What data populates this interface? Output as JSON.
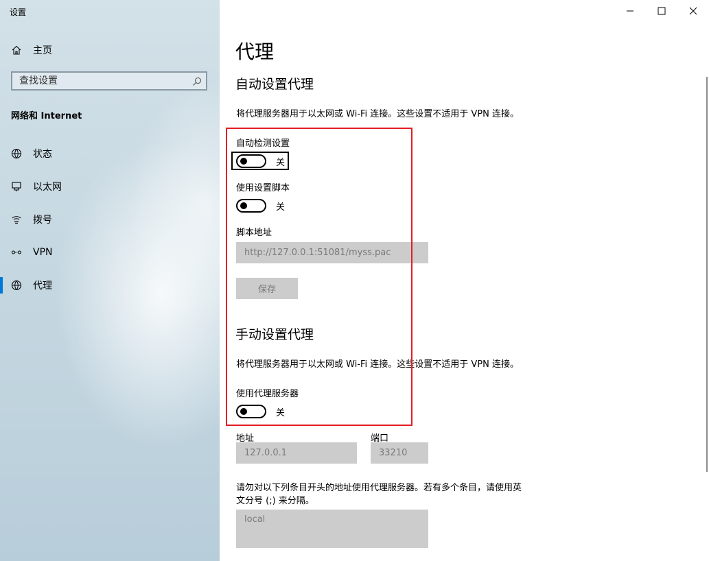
{
  "window": {
    "title": "设置",
    "controls": [
      "minimize-icon",
      "maximize-icon",
      "close-icon"
    ]
  },
  "sidebar": {
    "home": {
      "label": "主页",
      "icon": "home-icon"
    },
    "search": {
      "placeholder": "查找设置",
      "icon": "search-icon"
    },
    "section_title": "网络和 Internet",
    "items": [
      {
        "label": "状态",
        "icon": "globe-status-icon",
        "active": false
      },
      {
        "label": "以太网",
        "icon": "ethernet-icon",
        "active": false
      },
      {
        "label": "拨号",
        "icon": "dialup-icon",
        "active": false
      },
      {
        "label": "VPN",
        "icon": "vpn-icon",
        "active": false
      },
      {
        "label": "代理",
        "icon": "globe-icon",
        "active": true
      }
    ],
    "accent_color": "#0078d7"
  },
  "main": {
    "title": "代理",
    "auto": {
      "heading": "自动设置代理",
      "description": "将代理服务器用于以太网或 Wi-Fi 连接。这些设置不适用于 VPN 连接。",
      "detect": {
        "label": "自动检测设置",
        "state": "关"
      },
      "script": {
        "label": "使用设置脚本",
        "state": "关"
      },
      "script_address": {
        "label": "脚本地址",
        "value": "http://127.0.0.1:51081/myss.pac"
      },
      "save_label": "保存"
    },
    "manual": {
      "heading": "手动设置代理",
      "description": "将代理服务器用于以太网或 Wi-Fi 连接。这些设置不适用于 VPN 连接。",
      "use_proxy": {
        "label": "使用代理服务器",
        "state": "关"
      },
      "address": {
        "label": "地址",
        "value": "127.0.0.1"
      },
      "port": {
        "label": "端口",
        "value": "33210"
      },
      "exceptions": {
        "line1": "请勿对以下列条目开头的地址使用代理服务器。若有多个条目，请使用英",
        "line2": "文分号 (;) 来分隔。",
        "value": "local"
      }
    },
    "highlight_color": "#e31d24"
  }
}
